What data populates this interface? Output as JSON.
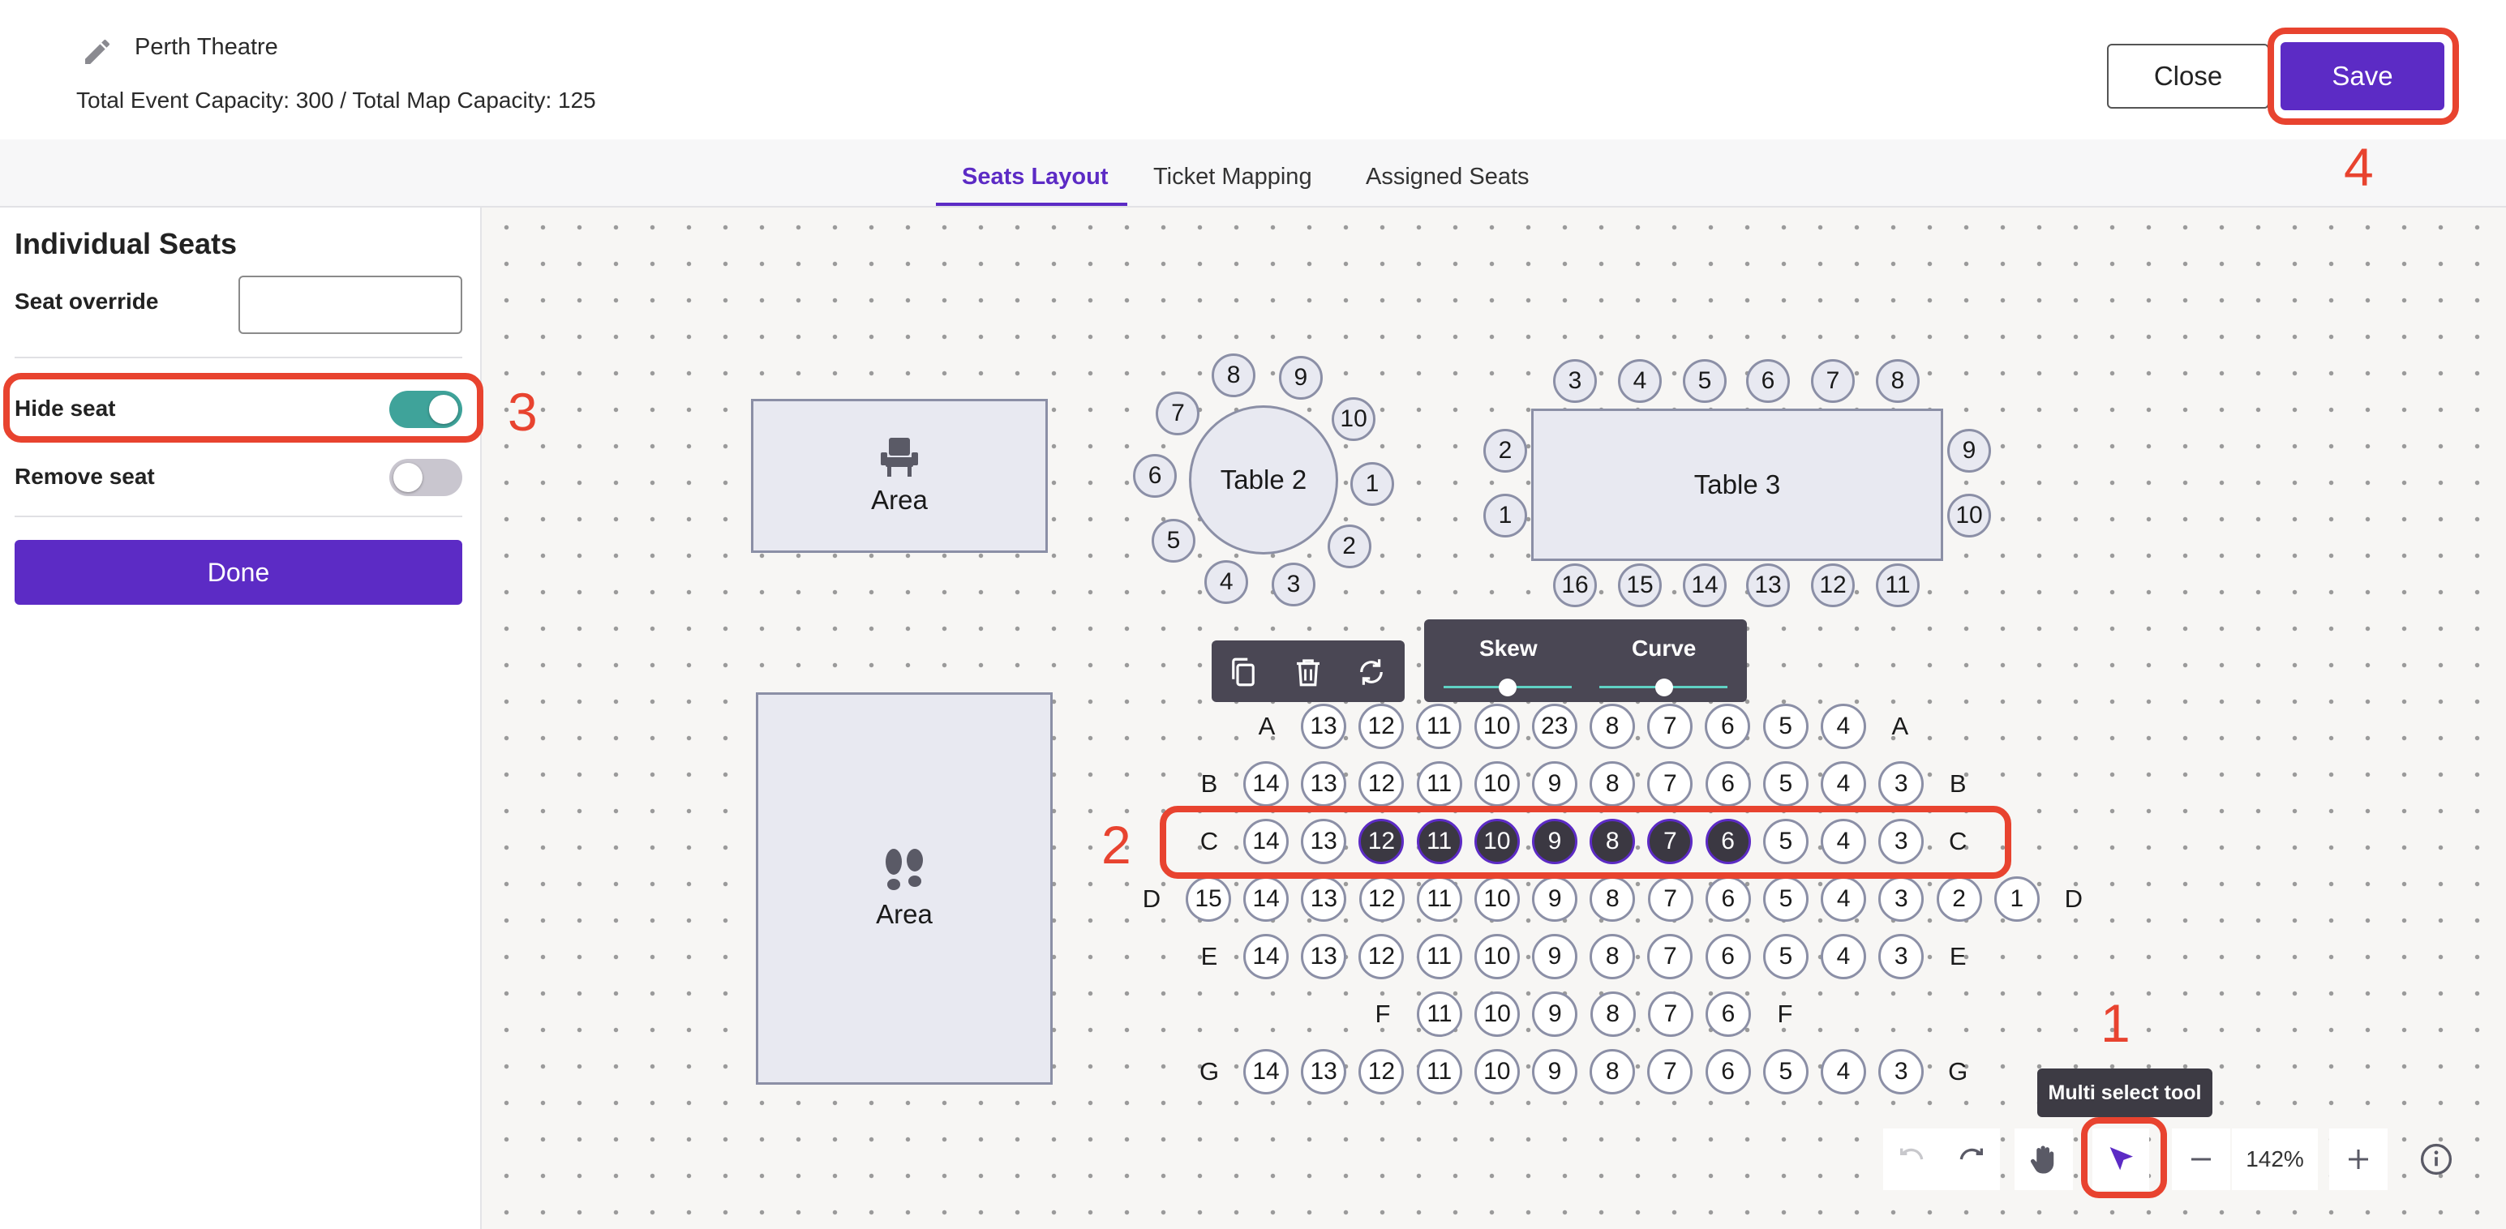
{
  "header": {
    "event_title": "Perth Theatre",
    "capacity_text": "Total Event Capacity: 300 / Total Map Capacity: 125",
    "close_label": "Close",
    "save_label": "Save"
  },
  "tabs": [
    {
      "label": "Seats Layout",
      "active": true
    },
    {
      "label": "Ticket Mapping",
      "active": false
    },
    {
      "label": "Assigned Seats",
      "active": false
    }
  ],
  "sidebar": {
    "title": "Individual Seats",
    "seat_override_label": "Seat override",
    "seat_override_value": "",
    "hide_seat_label": "Hide seat",
    "hide_seat_on": true,
    "remove_seat_label": "Remove seat",
    "remove_seat_on": false,
    "done_label": "Done"
  },
  "callouts": [
    "1",
    "2",
    "3",
    "4"
  ],
  "areas": [
    {
      "label": "Area",
      "icon": "chair-icon"
    },
    {
      "label": "Area",
      "icon": "footprints-icon"
    }
  ],
  "tables": {
    "table2": {
      "label": "Table 2",
      "seats": [
        "8",
        "9",
        "10",
        "1",
        "2",
        "3",
        "4",
        "5",
        "6",
        "7"
      ]
    },
    "table3": {
      "label": "Table 3",
      "top": [
        "3",
        "4",
        "5",
        "6",
        "7",
        "8"
      ],
      "bottom": [
        "16",
        "15",
        "14",
        "13",
        "12",
        "11"
      ],
      "left": [
        "2",
        "1"
      ],
      "right": [
        "9",
        "10"
      ]
    }
  },
  "seat_rows": [
    {
      "row": "A",
      "seats": [
        "13",
        "12",
        "11",
        "10",
        "23",
        "8",
        "7",
        "6",
        "5",
        "4"
      ],
      "selected": []
    },
    {
      "row": "B",
      "seats": [
        "14",
        "13",
        "12",
        "11",
        "10",
        "9",
        "8",
        "7",
        "6",
        "5",
        "4",
        "3"
      ],
      "selected": []
    },
    {
      "row": "C",
      "seats": [
        "14",
        "13",
        "12",
        "11",
        "10",
        "9",
        "8",
        "7",
        "6",
        "5",
        "4",
        "3"
      ],
      "selected": [
        "12",
        "11",
        "10",
        "9",
        "8",
        "7",
        "6"
      ]
    },
    {
      "row": "D",
      "seats": [
        "15",
        "14",
        "13",
        "12",
        "11",
        "10",
        "9",
        "8",
        "7",
        "6",
        "5",
        "4",
        "3",
        "2",
        "1"
      ],
      "selected": []
    },
    {
      "row": "E",
      "seats": [
        "14",
        "13",
        "12",
        "11",
        "10",
        "9",
        "8",
        "7",
        "6",
        "5",
        "4",
        "3"
      ],
      "selected": []
    },
    {
      "row": "F",
      "seats": [
        "11",
        "10",
        "9",
        "8",
        "7",
        "6"
      ],
      "selected": []
    },
    {
      "row": "G",
      "seats": [
        "14",
        "13",
        "12",
        "11",
        "10",
        "9",
        "8",
        "7",
        "6",
        "5",
        "4",
        "3"
      ],
      "selected": []
    }
  ],
  "seat_toolbar": {
    "icons": [
      "copy-icon",
      "trash-icon",
      "rotate-icon"
    ]
  },
  "seat_shape": {
    "skew_label": "Skew",
    "curve_label": "Curve"
  },
  "controls": {
    "tooltip": "Multi select tool",
    "zoom": "142%",
    "icons": [
      "undo-icon",
      "redo-icon",
      "hand-icon",
      "pointer-icon",
      "zoom-out-icon",
      "zoom-in-icon",
      "info-icon"
    ]
  },
  "colors": {
    "accent": "#5c2bc5",
    "annotation": "#e8432f",
    "toggle_on": "#3fa39a",
    "selected_seat": "#3b3842"
  }
}
